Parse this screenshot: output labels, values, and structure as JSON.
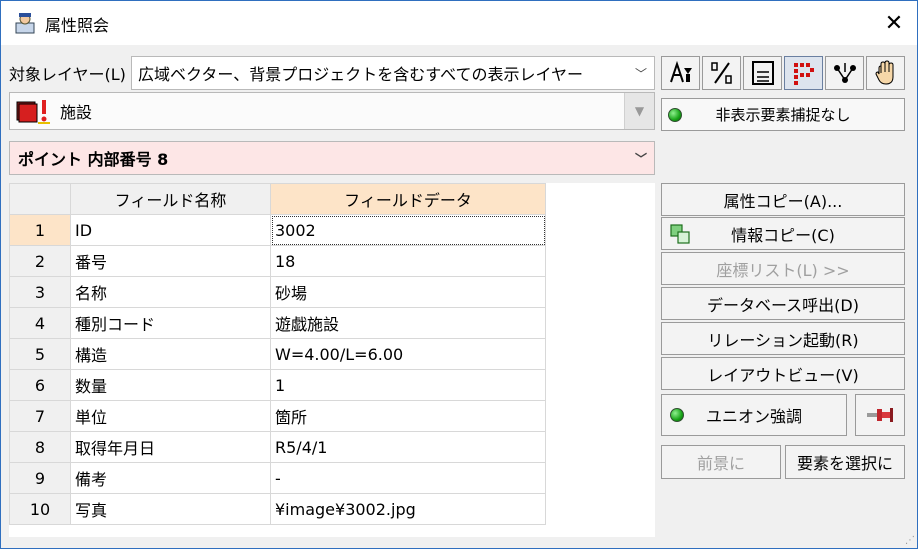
{
  "window": {
    "title": "属性照会",
    "close": "✕"
  },
  "layer": {
    "label": "対象レイヤー(L)",
    "selected": "広域ベクター、背景プロジェクトを含むすべての表示レイヤー"
  },
  "facility": {
    "selected": "施設"
  },
  "point": {
    "selected": "ポイント 内部番号 8"
  },
  "status": {
    "hidden_capture": "非表示要素捕捉なし"
  },
  "grid": {
    "headers": [
      "",
      "フィールド名称",
      "フィールドデータ"
    ],
    "rows": [
      {
        "no": "1",
        "name": "ID",
        "value": "3002"
      },
      {
        "no": "2",
        "name": "番号",
        "value": "18"
      },
      {
        "no": "3",
        "name": "名称",
        "value": "砂場"
      },
      {
        "no": "4",
        "name": "種別コード",
        "value": "遊戯施設"
      },
      {
        "no": "5",
        "name": "構造",
        "value": "W=4.00/L=6.00"
      },
      {
        "no": "6",
        "name": "数量",
        "value": "1"
      },
      {
        "no": "7",
        "name": "単位",
        "value": "箇所"
      },
      {
        "no": "8",
        "name": "取得年月日",
        "value": "R5/4/1"
      },
      {
        "no": "9",
        "name": "備考",
        "value": "-"
      },
      {
        "no": "10",
        "name": "写真",
        "value": "¥image¥3002.jpg"
      }
    ]
  },
  "buttons": {
    "copy_attr": "属性コピー(A)...",
    "copy_info": "情報コピー(C)",
    "coord_list": "座標リスト(L) >>",
    "db_call": "データベース呼出(D)",
    "relation": "リレーション起動(R)",
    "layout_view": "レイアウトビュー(V)",
    "union": "ユニオン強調",
    "foreground": "前景に",
    "select_element": "要素を選択に"
  },
  "colors": {
    "accent_selected": "#fde4c8",
    "point_bg": "#fde6e6",
    "led_green": "#18a418"
  }
}
